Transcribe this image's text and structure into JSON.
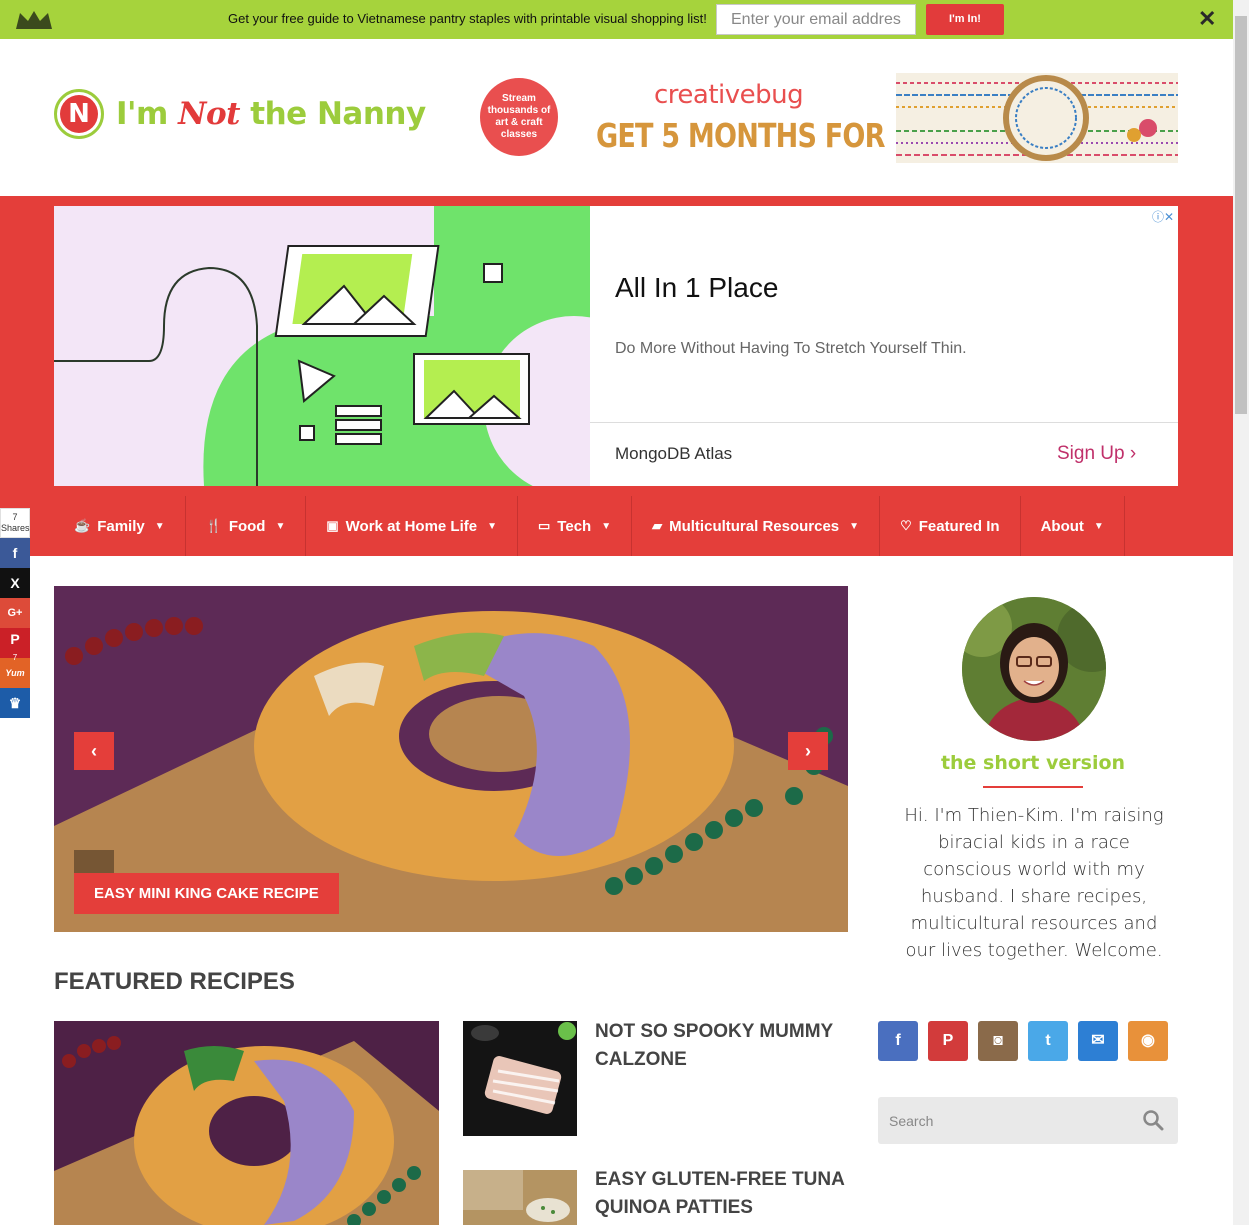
{
  "promo": {
    "message": "Get your free guide to Vietnamese pantry staples with printable visual shopping list!",
    "email_placeholder": "Enter your email addres",
    "submit_label": "I'm In!",
    "close_glyph": "✕",
    "crown_icon": "crown-icon"
  },
  "site": {
    "logo_letter": "N",
    "name_part1": "I'm ",
    "name_part2": "Not",
    "name_part3": " the Nanny"
  },
  "header_ad": {
    "circle_text": "Stream thousands of art & craft classes",
    "brand": "creativebug",
    "offer": "GET 5 MONTHS FOR"
  },
  "banner_ad": {
    "title": "All In 1 Place",
    "description": "Do More Without Having To Stretch Yourself Thin.",
    "advertiser": "MongoDB Atlas",
    "cta": "Sign Up",
    "info_icons": "ⓘ✕"
  },
  "nav": {
    "items": [
      {
        "label": "Family",
        "icon": "coffee-icon"
      },
      {
        "label": "Food",
        "icon": "utensils-icon"
      },
      {
        "label": "Work at Home Life",
        "icon": "briefcase-icon"
      },
      {
        "label": "Tech",
        "icon": "laptop-icon"
      },
      {
        "label": "Multicultural Resources",
        "icon": "book-icon"
      },
      {
        "label": "Featured In",
        "icon": "heart-icon"
      },
      {
        "label": "About",
        "icon": ""
      }
    ]
  },
  "share": {
    "count": "7",
    "count_label": "Shares",
    "pinterest_count": "7",
    "buttons": [
      "facebook-icon",
      "x-icon",
      "google-plus-icon",
      "pinterest-icon",
      "yummly-icon",
      "sumo-icon"
    ]
  },
  "slider": {
    "caption": "EASY MINI KING CAKE RECIPE",
    "prev": "‹",
    "next": "›"
  },
  "sidebar": {
    "short_title": "the short version",
    "bio": "Hi. I'm Thien-Kim. I'm raising biracial kids in a race conscious world with my husband. I share recipes, multicultural resources and our lives together. Welcome.",
    "search_placeholder": "Search",
    "socials": [
      {
        "icon": "facebook-icon",
        "glyph": "f",
        "color": "#4a6fbf"
      },
      {
        "icon": "pinterest-icon",
        "glyph": "P",
        "color": "#d23b3b"
      },
      {
        "icon": "instagram-icon",
        "glyph": "◙",
        "color": "#8a6a4a"
      },
      {
        "icon": "twitter-icon",
        "glyph": "t",
        "color": "#4aa8e8"
      },
      {
        "icon": "email-icon",
        "glyph": "✉",
        "color": "#2d7fd4"
      },
      {
        "icon": "rss-icon",
        "glyph": "◉",
        "color": "#e8913a"
      }
    ]
  },
  "featured": {
    "heading": "FEATURED RECIPES",
    "recipes": [
      {
        "title": "NOT SO SPOOKY MUMMY CALZONE"
      },
      {
        "title": "EASY GLUTEN-FREE TUNA QUINOA PATTIES"
      }
    ]
  },
  "colors": {
    "promo_green": "#a6d33c",
    "brand_red": "#e43e3a",
    "brand_green": "#9ccc3c"
  }
}
